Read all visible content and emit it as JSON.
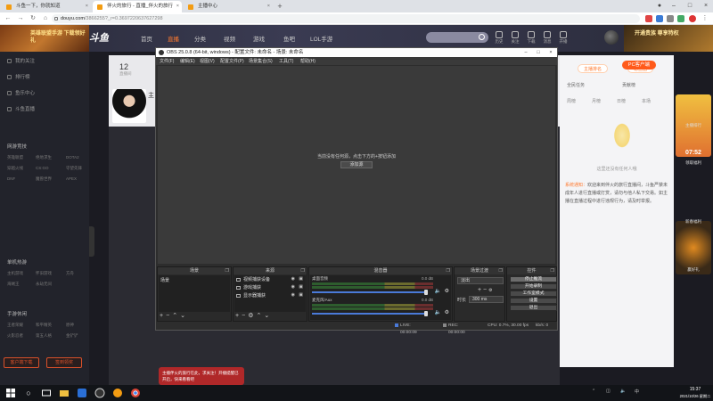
{
  "browser": {
    "tabs": [
      {
        "label": "斗鱼一下，你就知道"
      },
      {
        "label": "伴火的旅行 - 直播_伴火的旅行"
      },
      {
        "label": "主播中心"
      }
    ],
    "url_host": "douyu.com",
    "url_path": "/3866255?_r=0.3697220637627298"
  },
  "header": {
    "banner": "英雄联盟手游 下载领好礼",
    "logo": "斗鱼",
    "nav": [
      {
        "label": "首页"
      },
      {
        "label": "直播"
      },
      {
        "label": "分类"
      },
      {
        "label": "视频"
      },
      {
        "label": "游戏"
      },
      {
        "label": "鱼吧"
      },
      {
        "label": "LOL手游"
      }
    ],
    "icons": [
      {
        "label": "历史",
        "icon": "history-icon"
      },
      {
        "label": "关注",
        "icon": "follow-icon"
      },
      {
        "label": "下载",
        "icon": "download-icon"
      },
      {
        "label": "消息",
        "icon": "message-icon"
      },
      {
        "label": "开播",
        "icon": "live-icon"
      }
    ],
    "promo": "开通贵族 尊享特权"
  },
  "sidebar": {
    "items": [
      {
        "label": "我的关注",
        "icon": "heart-icon"
      },
      {
        "label": "排行榜",
        "icon": "rank-icon"
      },
      {
        "label": "鱼乐中心",
        "icon": "fish-icon"
      },
      {
        "label": "斗鱼直播",
        "icon": "tv-icon"
      }
    ],
    "sections": [
      {
        "label": "网游竞技",
        "cells": [
          "英雄联盟",
          "绝地求生",
          "DOTA2",
          "穿越火线",
          "CS:GO",
          "守望先锋",
          "DNF",
          "魔兽世界",
          "APEX"
        ]
      },
      {
        "label": "单机热游",
        "cells": [
          "主机游戏",
          "怀旧游戏",
          "方舟",
          "海贼王",
          "永劫无间"
        ]
      },
      {
        "label": "手游休闲",
        "cells": [
          "王者荣耀",
          "和平精英",
          "原神",
          "火影忍者",
          "第五人格",
          "金铲铲"
        ]
      }
    ],
    "btn_left": "客户端下载",
    "btn_right": "签到领奖"
  },
  "room": {
    "number": "12",
    "number_sub": "直播间",
    "title_prefix": "主"
  },
  "obs": {
    "title": "OBS 25.0.8 (64-bit, windows) - 配置文件: 未命名 - 场景: 未命名",
    "menu": [
      "文件(F)",
      "编辑(E)",
      "视图(V)",
      "配置文件(P)",
      "场景集合(S)",
      "工具(T)",
      "帮助(H)"
    ],
    "preview_msg": "当前没有任何源，点击下方的+按钮添加",
    "preview_btn": "添加源",
    "docks": {
      "scenes": {
        "title": "场景",
        "items": [
          "场景"
        ]
      },
      "sources": {
        "title": "来源",
        "items": [
          {
            "name": "视频捕获设备",
            "icon": "camera-icon"
          },
          {
            "name": "游戏捕获",
            "icon": "gamepad-icon"
          },
          {
            "name": "显示器捕获",
            "icon": "monitor-icon"
          }
        ]
      },
      "mixer": {
        "title": "混音器",
        "tracks": [
          {
            "name": "桌面音频",
            "db": "0.0 dB"
          },
          {
            "name": "麦克风/Aux",
            "db": "0.0 dB"
          }
        ]
      },
      "transitions": {
        "title": "场景过渡",
        "type": "淡出",
        "duration_label": "时长",
        "duration": "300 ms"
      },
      "controls": {
        "title": "控件",
        "buttons": [
          "停止推流",
          "开始录制",
          "工作室模式",
          "设置",
          "退出"
        ]
      }
    },
    "status": {
      "live": "LIVE: 00:00:09",
      "rec": "REC: 00:00:00",
      "cpu": "CPU: 0.7%, 30.00 fps",
      "kb": "kb/s: 0"
    }
  },
  "right_panel": {
    "pc_badge": "PC客户端",
    "tabs": [
      "全民任务",
      "贡献榜"
    ],
    "btn_a": "主播排名",
    "btn_b": "粉丝团",
    "subtabs": [
      "周榜",
      "月榜",
      "日榜",
      "本场"
    ],
    "empty_text": "这里还没有任何人哦",
    "notice_label": "系统通知：",
    "notice": "欢迎来到伴火的旅行直播间，斗鱼严禁未成年人进行直播或打赏，请勿与他人私下交易。如主播在直播过程中进行违规行为，请及时举报。"
  },
  "right_strip": {
    "tile1": "主播排行",
    "timer": "07:52",
    "tile1_sub": "领取福利",
    "tile2": "新春福利",
    "tile2_sub": "赢好礼"
  },
  "toast": {
    "text": "主播伴火的旅行在此，求关注！开播提醒已开启，快来看看吧"
  },
  "taskbar": {
    "time": "15:37",
    "date": "2021/10/26 星期二"
  },
  "colors": {
    "accent": "#ff7a2f",
    "obs_bg": "#2d2d2d",
    "page_bg": "#1b1b22"
  }
}
